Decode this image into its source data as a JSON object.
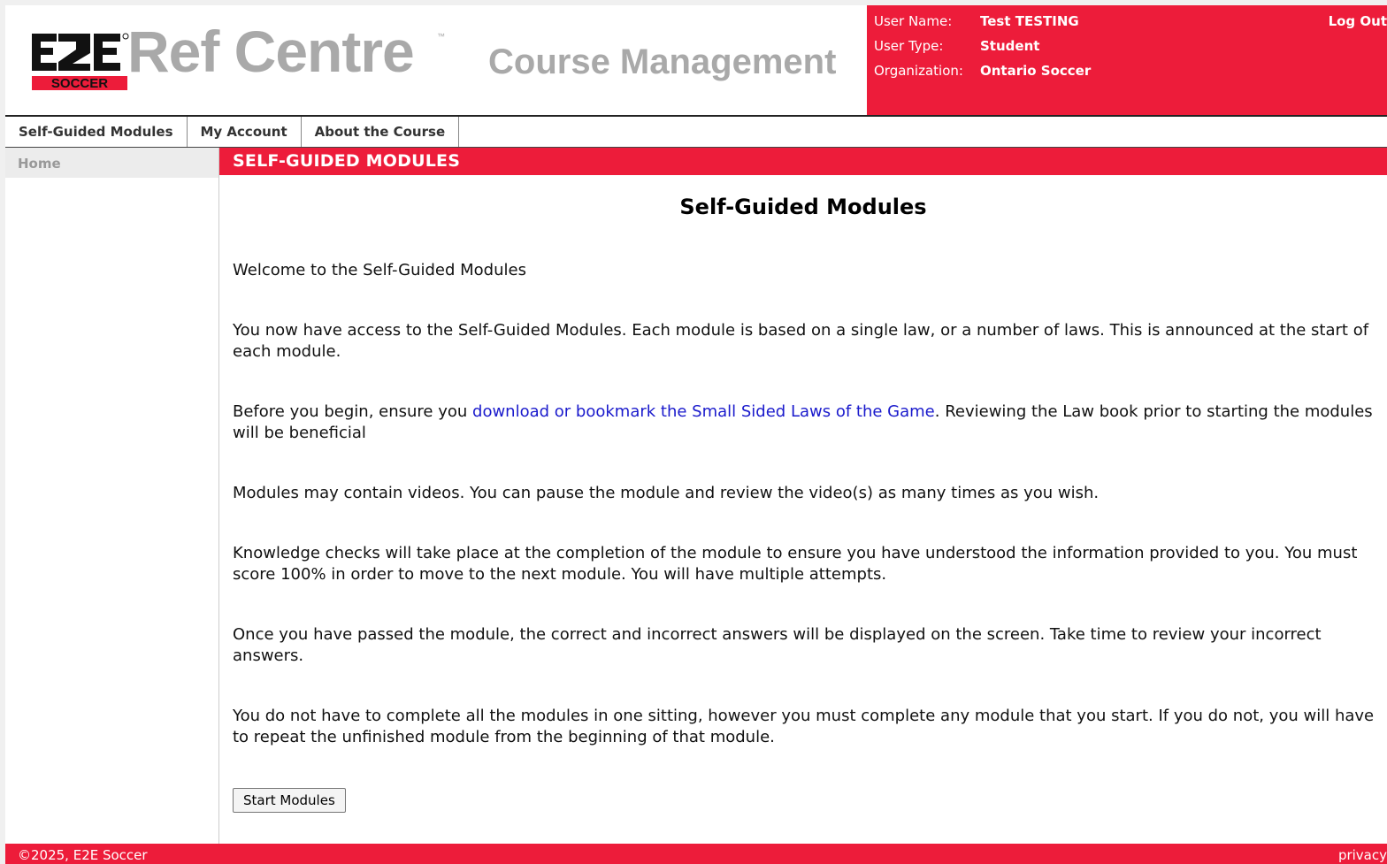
{
  "header": {
    "logo_text": "E2E SOCCER",
    "brand": "Ref Centre",
    "trademark": "™",
    "subtitle": "Course Management"
  },
  "user": {
    "name_label": "User Name:",
    "name_value": "Test TESTING",
    "type_label": "User Type:",
    "type_value": "Student",
    "org_label": "Organization:",
    "org_value": "Ontario Soccer",
    "logout": "Log Out"
  },
  "nav": {
    "tabs": [
      "Self-Guided Modules",
      "My Account",
      "About the Course"
    ]
  },
  "sidebar": {
    "home": "Home"
  },
  "main": {
    "section_bar": "SELF-GUIDED MODULES",
    "heading": "Self-Guided Modules",
    "welcome": "Welcome to the Self-Guided Modules",
    "access": "You now have access to the Self-Guided Modules. Each module is based on a single law, or a number of laws. This is announced at the start of each module.",
    "begin_prefix": "Before you begin, ensure you ",
    "begin_link": "download or bookmark the Small Sided Laws of the Game",
    "begin_suffix": ". Reviewing the Law book prior to starting the modules will be beneficial",
    "videos": "Modules may contain videos. You can pause the module and review the video(s) as many times as you wish.",
    "checks": "Knowledge checks will take place at the completion of the module to ensure you have understood the information provided to you. You must score 100% in order to move to the next module. You will have multiple attempts.",
    "passed": "Once you have passed the module, the correct and incorrect answers will be displayed on the screen. Take time to review your incorrect answers.",
    "sitting": "You do not have to complete all the modules in one sitting, however you must complete any module that you start. If you do not, you will have to repeat the unfinished module from the beginning of that module.",
    "start_button": "Start Modules"
  },
  "footer": {
    "copyright": "©2025, E2E Soccer",
    "privacy": "privacy"
  },
  "colors": {
    "accent": "#ed1c3a",
    "brand_gray": "#a9a9a9",
    "link": "#1a1acc"
  }
}
